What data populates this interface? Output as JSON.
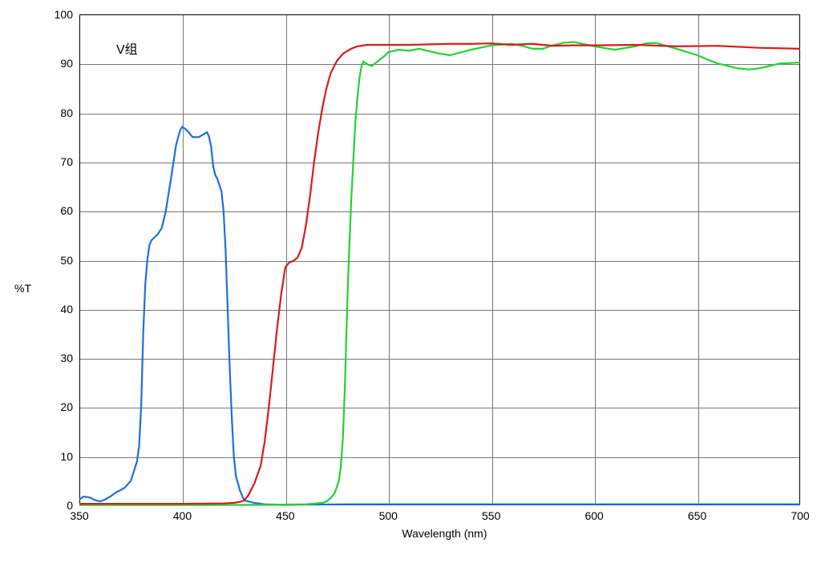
{
  "chart_data": {
    "type": "line",
    "title": "",
    "legend": {
      "label": "V组",
      "position": "upper-left"
    },
    "xlabel": "Wavelength (nm)",
    "ylabel": "%T",
    "xlim": [
      350,
      700
    ],
    "ylim": [
      0,
      100
    ],
    "x_ticks": [
      350,
      400,
      450,
      500,
      550,
      600,
      650,
      700
    ],
    "y_ticks": [
      0,
      10,
      20,
      30,
      40,
      50,
      60,
      70,
      80,
      90,
      100
    ],
    "series": [
      {
        "name": "blue",
        "color": "#1f6fd8",
        "x": [
          350,
          352,
          355,
          358,
          360,
          362,
          365,
          368,
          370,
          372,
          375,
          378,
          379,
          380,
          381,
          382,
          383,
          384,
          385,
          388,
          390,
          392,
          395,
          397,
          399,
          400,
          402,
          405,
          408,
          410,
          412,
          413,
          414,
          415,
          416,
          417,
          419,
          420,
          421,
          422,
          423,
          424,
          425,
          426,
          428,
          430,
          435,
          440,
          450,
          460,
          480,
          500,
          550,
          600,
          650,
          700
        ],
        "values": [
          1.2,
          1.8,
          1.6,
          1.0,
          0.8,
          1.1,
          1.8,
          2.7,
          3.1,
          3.6,
          5.0,
          9.0,
          12.0,
          20.0,
          35.0,
          45.0,
          50.0,
          53.0,
          54.0,
          55.2,
          56.5,
          60.0,
          68.0,
          73.5,
          76.5,
          77.1,
          76.5,
          75.0,
          75.0,
          75.5,
          76.0,
          75.0,
          73.0,
          69.0,
          67.3,
          66.5,
          64.0,
          60.0,
          52.0,
          40.0,
          28.0,
          18.0,
          10.0,
          6.0,
          3.0,
          1.0,
          0.5,
          0.2,
          0.1,
          0.15,
          0.2,
          0.2,
          0.2,
          0.2,
          0.2,
          0.2
        ]
      },
      {
        "name": "green",
        "color": "#22d233",
        "x": [
          350,
          400,
          440,
          460,
          468,
          470,
          472,
          474,
          476,
          477,
          478,
          479,
          480,
          481,
          482,
          483,
          484,
          485,
          486,
          487,
          488,
          490,
          492,
          495,
          498,
          500,
          505,
          510,
          515,
          520,
          525,
          530,
          540,
          550,
          560,
          565,
          570,
          575,
          580,
          585,
          590,
          600,
          610,
          620,
          625,
          630,
          640,
          650,
          655,
          660,
          665,
          670,
          675,
          680,
          685,
          690,
          700
        ],
        "values": [
          0.05,
          0.05,
          0.1,
          0.2,
          0.5,
          0.8,
          1.5,
          2.5,
          5.0,
          8.0,
          14.0,
          25.0,
          40.0,
          52.0,
          62.0,
          70.0,
          78.0,
          83.0,
          87.0,
          89.5,
          90.4,
          89.8,
          89.5,
          90.5,
          91.5,
          92.3,
          92.8,
          92.6,
          93.0,
          92.5,
          92.0,
          91.7,
          92.8,
          93.7,
          94.0,
          93.6,
          93.0,
          93.0,
          93.7,
          94.2,
          94.4,
          93.5,
          92.8,
          93.5,
          94.1,
          94.2,
          93.0,
          91.7,
          90.8,
          90.0,
          89.5,
          89.0,
          88.8,
          89.0,
          89.5,
          90.0,
          90.2
        ]
      },
      {
        "name": "red",
        "color": "#d81b1b",
        "x": [
          350,
          400,
          420,
          425,
          428,
          430,
          432,
          435,
          438,
          440,
          442,
          444,
          446,
          448,
          450,
          452,
          454,
          456,
          458,
          460,
          462,
          464,
          466,
          468,
          470,
          472,
          475,
          478,
          480,
          482,
          485,
          490,
          500,
          510,
          520,
          530,
          540,
          550,
          560,
          570,
          580,
          590,
          600,
          620,
          640,
          660,
          680,
          700
        ],
        "values": [
          0.3,
          0.3,
          0.4,
          0.5,
          0.7,
          1.0,
          2.0,
          4.5,
          8.0,
          13.0,
          20.0,
          28.0,
          36.0,
          43.0,
          48.5,
          49.5,
          49.8,
          50.5,
          52.5,
          57.0,
          63.0,
          70.0,
          76.0,
          81.0,
          85.0,
          88.0,
          90.5,
          92.0,
          92.5,
          93.0,
          93.5,
          93.8,
          93.8,
          93.8,
          93.9,
          94.0,
          94.0,
          94.1,
          93.8,
          94.0,
          93.6,
          93.7,
          93.7,
          93.8,
          93.5,
          93.6,
          93.2,
          93.0
        ]
      }
    ]
  }
}
